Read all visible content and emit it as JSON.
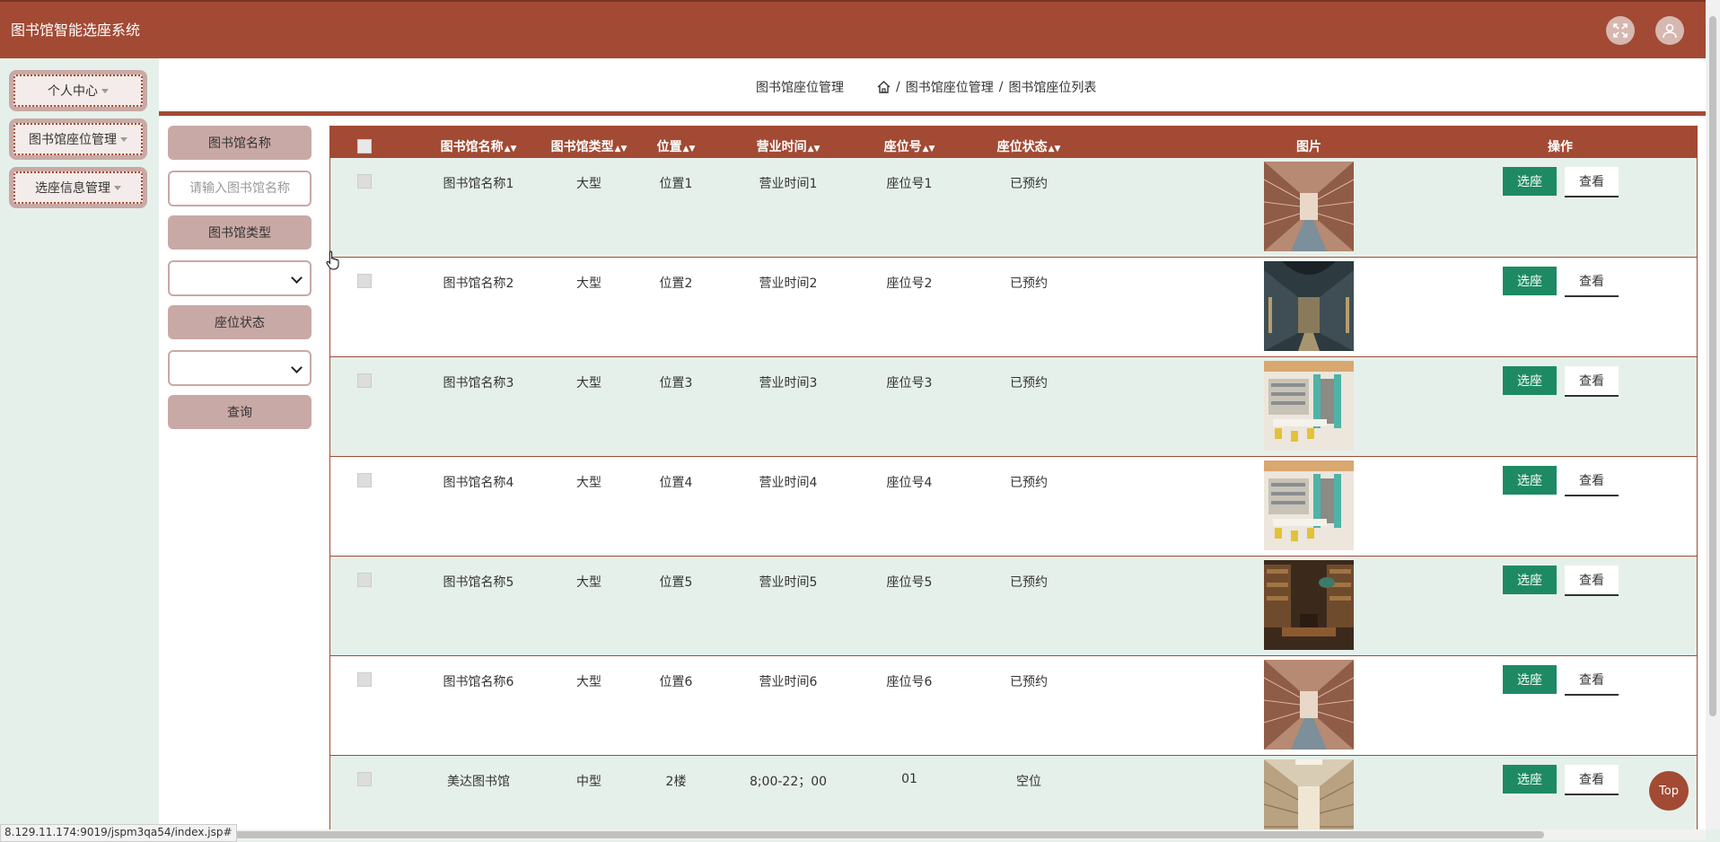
{
  "app_title": "图书馆智能选座系统",
  "sidebar": {
    "items": [
      {
        "label": "个人中心"
      },
      {
        "label": "图书馆座位管理"
      },
      {
        "label": "选座信息管理"
      }
    ]
  },
  "breadcrumb": {
    "title": "图书馆座位管理",
    "path1": "图书馆座位管理",
    "path2": "图书馆座位列表",
    "sep": "/"
  },
  "search": {
    "name_label": "图书馆名称",
    "name_placeholder": "请输入图书馆名称",
    "type_label": "图书馆类型",
    "status_label": "座位状态",
    "query_button": "查询"
  },
  "table": {
    "headers": [
      "图书馆名称",
      "图书馆类型",
      "位置",
      "营业时间",
      "座位号",
      "座位状态",
      "图片",
      "操作"
    ],
    "select_label": "选座",
    "view_label": "查看",
    "rows": [
      {
        "name": "图书馆名称1",
        "type": "大型",
        "location": "位置1",
        "hours": "营业时间1",
        "seat": "座位号1",
        "status": "已预约",
        "image": "corridor"
      },
      {
        "name": "图书馆名称2",
        "type": "大型",
        "location": "位置2",
        "hours": "营业时间2",
        "seat": "座位号2",
        "status": "已预约",
        "image": "hall"
      },
      {
        "name": "图书馆名称3",
        "type": "大型",
        "location": "位置3",
        "hours": "营业时间3",
        "seat": "座位号3",
        "status": "已预约",
        "image": "bright"
      },
      {
        "name": "图书馆名称4",
        "type": "大型",
        "location": "位置4",
        "hours": "营业时间4",
        "seat": "座位号4",
        "status": "已预约",
        "image": "bright"
      },
      {
        "name": "图书馆名称5",
        "type": "大型",
        "location": "位置5",
        "hours": "营业时间5",
        "seat": "座位号5",
        "status": "已预约",
        "image": "dark"
      },
      {
        "name": "图书馆名称6",
        "type": "大型",
        "location": "位置6",
        "hours": "营业时间6",
        "seat": "座位号6",
        "status": "已预约",
        "image": "corridor"
      },
      {
        "name": "美达图书馆",
        "type": "中型",
        "location": "2楼",
        "hours": "8;00-22；00",
        "seat": "01",
        "status": "空位",
        "image": "aisle"
      }
    ]
  },
  "status_url": "8.129.11.174:9019/jspm3qa54/index.jsp#",
  "top_button": "Top",
  "colors": {
    "brand": "#a24a34",
    "accent_green": "#1e8a63",
    "row_tint": "#e6f0ea"
  }
}
